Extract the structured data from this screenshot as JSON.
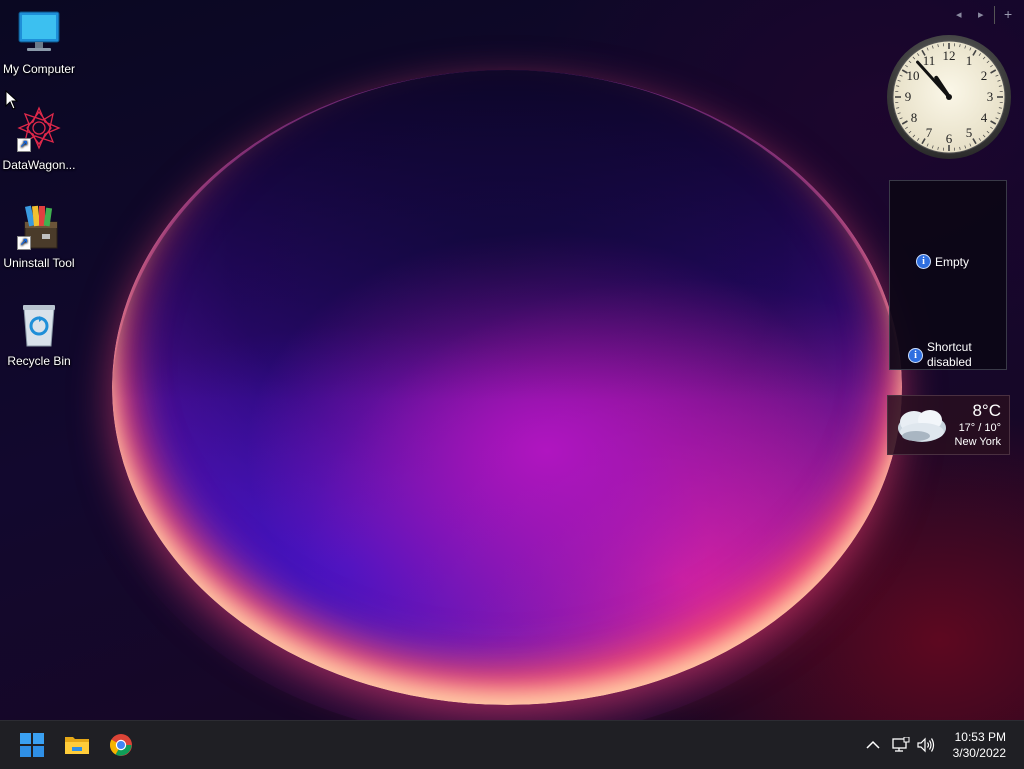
{
  "desktop": {
    "icons": [
      {
        "label": "My Computer",
        "icon": "monitor-icon"
      },
      {
        "label": "DataWagon...",
        "icon": "datawagon-icon"
      },
      {
        "label": "Uninstall Tool",
        "icon": "uninstall-tool-icon"
      },
      {
        "label": "Recycle Bin",
        "icon": "recycle-bin-icon"
      }
    ]
  },
  "gadgets": {
    "controls": {
      "prev": "◂",
      "next": "▸",
      "add": "+"
    },
    "clock": {
      "hour": 10,
      "minute": 53
    },
    "slideshow": {
      "empty_text": "Empty",
      "shortcut_text_line1": "Shortcut",
      "shortcut_text_line2": "disabled",
      "info_glyph": "i"
    },
    "weather": {
      "temperature": "8°C",
      "range": "17° / 10°",
      "city": "New York",
      "icon": "cloudy-icon"
    }
  },
  "taskbar": {
    "apps": [
      {
        "name": "Start",
        "icon": "windows-start-icon"
      },
      {
        "name": "File Explorer",
        "icon": "folder-icon"
      },
      {
        "name": "Google Chrome",
        "icon": "chrome-icon"
      }
    ],
    "tray": {
      "chevron": "^",
      "time": "10:53 PM",
      "date": "3/30/2022"
    }
  },
  "colors": {
    "taskbar_bg": "#1f1f24",
    "info_icon": "#2f6fe0"
  }
}
